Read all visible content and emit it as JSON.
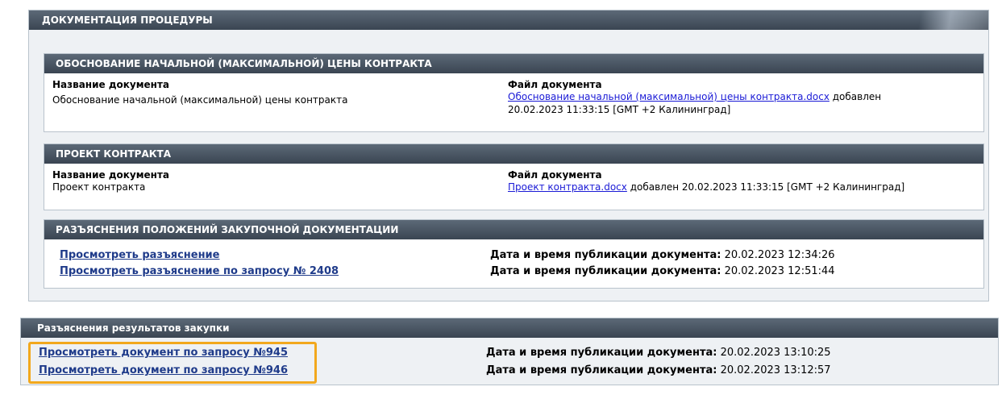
{
  "main_section": {
    "title": "ДОКУМЕНТАЦИЯ ПРОЦЕДУРЫ",
    "nmck": {
      "title": "ОБОСНОВАНИЕ НАЧАЛЬНОЙ (МАКСИМАЛЬНОЙ) ЦЕНЫ КОНТРАКТА",
      "doc_name_label": "Название документа",
      "doc_name": "Обоснование начальной (максимальной) цены контракта",
      "file_label": "Файл документа",
      "file_link": "Обоснование начальной (максимальной) цены контракта.docx",
      "added_text": " добавлен",
      "added_date": "20.02.2023 11:33:15 [GMT +2 Калининград]"
    },
    "project": {
      "title": "ПРОЕКТ КОНТРАКТА",
      "doc_name_label": "Название документа",
      "doc_name": "Проект контракта",
      "file_label": "Файл документа",
      "file_link": "Проект контракта.docx",
      "added_text": " добавлен 20.02.2023 11:33:15 [GMT +2 Калининград]"
    },
    "clarifications": {
      "title": "РАЗЪЯСНЕНИЯ ПОЛОЖЕНИЙ ЗАКУПОЧНОЙ ДОКУМЕНТАЦИИ",
      "rows": [
        {
          "link": "Просмотреть разъяснение",
          "date_label": "Дата и время публикации документа:",
          "date": " 20.02.2023 12:34:26"
        },
        {
          "link": "Просмотреть разъяснение по запросу № 2408",
          "date_label": "Дата и время публикации документа:",
          "date": " 20.02.2023 12:51:44"
        }
      ]
    }
  },
  "results_section": {
    "title": "Разъяснения результатов закупки",
    "rows": [
      {
        "link": "Просмотреть документ по запросу №945",
        "date_label": "Дата и время публикации документа:",
        "date": " 20.02.2023 13:10:25"
      },
      {
        "link": "Просмотреть документ по запросу №946",
        "date_label": "Дата и время публикации документа:",
        "date": " 20.02.2023 13:12:57"
      }
    ]
  },
  "colors": {
    "header_dark": "#3a4552",
    "panel_bg": "#eef1f4",
    "link": "#1a1ad6",
    "link_bold": "#1f3b8a",
    "highlight": "#f2a81d"
  }
}
